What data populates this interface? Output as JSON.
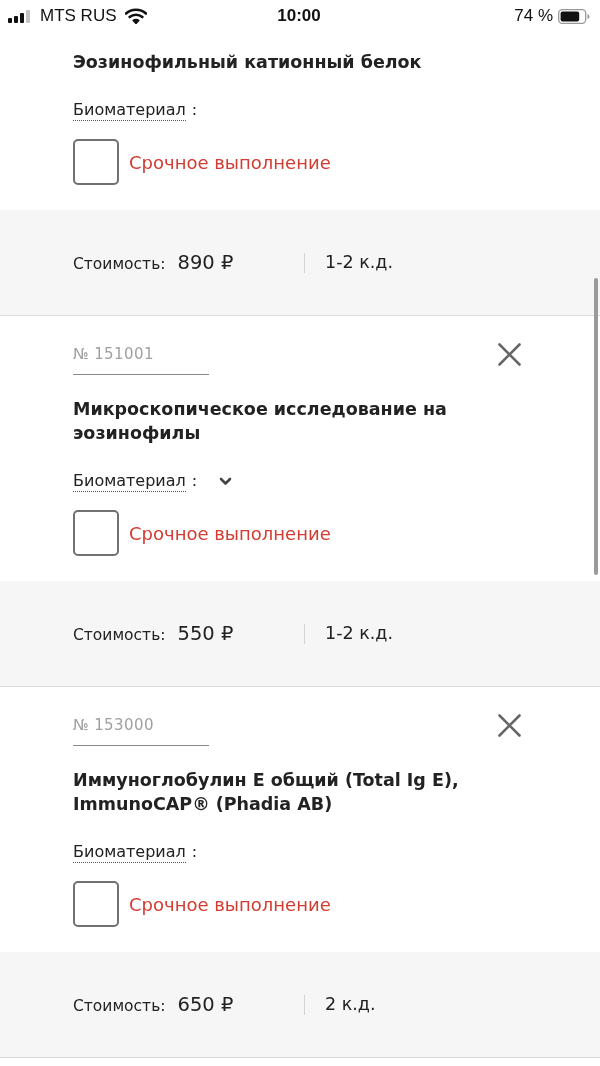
{
  "status_bar": {
    "carrier": "MTS RUS",
    "time": "10:00",
    "battery_text": "74 %"
  },
  "items": [
    {
      "title": "Эозинофильный катионный белок",
      "biomaterial": {
        "label": "Биоматериал",
        "colon": ":",
        "dropdown": false
      },
      "urgent": {
        "label": "Срочное выполнение",
        "checked": false
      },
      "cost": {
        "label": "Стоимость:",
        "price": "890 ₽",
        "duration": "1-2 к.д."
      }
    },
    {
      "number": {
        "placeholder": "№ 151001"
      },
      "title": "Микроскопическое исследование на эозинофилы",
      "biomaterial": {
        "label": "Биоматериал",
        "colon": ":",
        "dropdown": true
      },
      "urgent": {
        "label": "Срочное выполнение",
        "checked": false
      },
      "cost": {
        "label": "Стоимость:",
        "price": "550 ₽",
        "duration": "1-2 к.д."
      }
    },
    {
      "number": {
        "placeholder": "№ 153000"
      },
      "title": "Иммуноглобулин E общий (Total Ig E), ImmunoCAP® (Phadia AB)",
      "biomaterial": {
        "label": "Биоматериал",
        "colon": ":",
        "dropdown": false
      },
      "urgent": {
        "label": "Срочное выполнение",
        "checked": false
      },
      "cost": {
        "label": "Стоимость:",
        "price": "650 ₽",
        "duration": "2 к.д."
      }
    }
  ]
}
